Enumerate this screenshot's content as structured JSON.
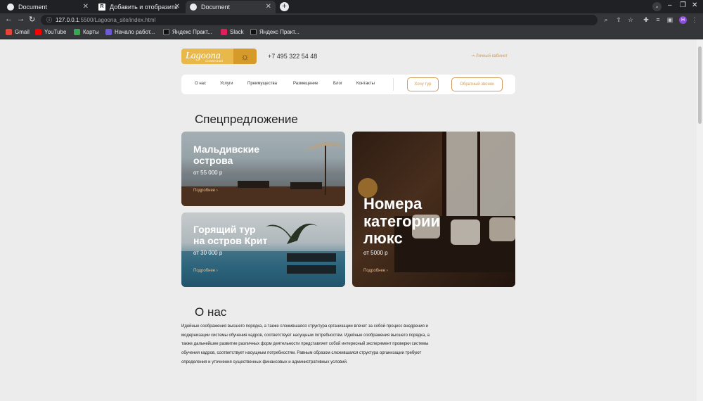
{
  "browser": {
    "tabs": [
      {
        "title": "Document",
        "active": false
      },
      {
        "title": "Добавить и отобразить",
        "active": false
      },
      {
        "title": "Document",
        "active": true
      }
    ],
    "url_host": "127.0.0.1",
    "url_path": ":5500/Lagoona_site/index.html",
    "profile_initial": "H",
    "bookmarks": [
      {
        "label": "Gmail",
        "color": "#ea4335"
      },
      {
        "label": "YouTube",
        "color": "#ff0000"
      },
      {
        "label": "Карты",
        "color": "#34a853"
      },
      {
        "label": "Начало работ...",
        "color": "#6b5bd6"
      },
      {
        "label": "Яндекс Практ...",
        "color": "#111111"
      },
      {
        "label": "Slack",
        "color": "#e01e5a"
      },
      {
        "label": "Яндекс Практ...",
        "color": "#111111"
      }
    ]
  },
  "header": {
    "logo": "Lagoona",
    "logo_sub": "СОЛНЕЧНАЯ",
    "phone": "+7 495 322 54 48",
    "cabinet": "Личный кабинет"
  },
  "nav": {
    "items": [
      "О нас",
      "Услуги",
      "Преимущества",
      "Размещение",
      "Блог",
      "Контакты"
    ],
    "tour_button": "Хочу тур",
    "callback_button": "Обратный звонок"
  },
  "offers": {
    "title": "Спецпредложение",
    "cards": [
      {
        "title": "Мальдивские\nострова",
        "price": "от 55 000 р",
        "more": "Подробнее"
      },
      {
        "title": "Горящий тур\nна остров Крит",
        "price": "от 30 000 р",
        "more": "Подробнее"
      },
      {
        "title": "Номера\nкатегории\nлюкс",
        "price": "от 5000 р",
        "more": "Подробнее"
      }
    ]
  },
  "about": {
    "title": "О нас",
    "text": "Идейные соображения высшего порядка, а также сложившаяся структура организации влечет за собой процесс внедрения и модернизации системы обучения кадров, соответствует насущным потребностям. Идейные соображения высшего порядка, а также дальнейшее развитие различных форм деятельности представляет собой интересный эксперимент проверки системы обучения кадров, соответствует насущным потребностям. Равным образом сложившаяся структура организации требуют определения и уточнения существенных финансовых и административных условий."
  },
  "colors": {
    "accent": "#d09a5a",
    "logo_bg": "#e8b84a",
    "page_bg": "#ececec"
  }
}
